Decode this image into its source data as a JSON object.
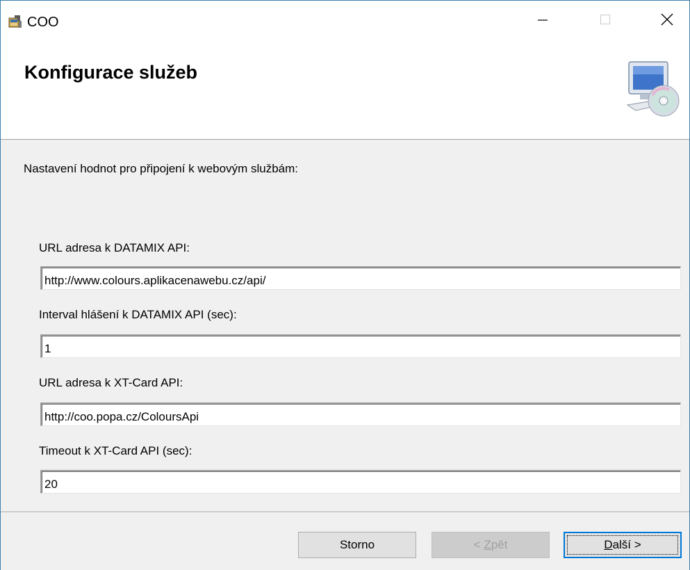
{
  "window": {
    "title": "COO",
    "icons": {
      "app": "installer-icon",
      "minimize": "minimize-icon",
      "maximize": "maximize-icon",
      "close": "close-icon"
    }
  },
  "banner": {
    "title": "Konfigurace služeb",
    "icon": "computer-cd-icon"
  },
  "intro": "Nastavení hodnot pro připojení k webovým službám:",
  "fields": [
    {
      "label": "URL adresa k DATAMIX API:",
      "value": "http://www.colours.aplikacenawebu.cz/api/"
    },
    {
      "label": "Interval hlášení k DATAMIX API (sec):",
      "value": "1"
    },
    {
      "label": "URL adresa k XT-Card API:",
      "value": "http://coo.popa.cz/ColoursApi"
    },
    {
      "label": "Timeout k XT-Card API (sec):",
      "value": "20"
    }
  ],
  "buttons": {
    "cancel": "Storno",
    "back": {
      "prefix": "< ",
      "accel": "Z",
      "rest": "pět",
      "enabled": false
    },
    "next": {
      "accel": "D",
      "rest": "alší >",
      "enabled": true,
      "focused": true
    }
  },
  "colors": {
    "window_border": "#3c7fb1",
    "focus_border": "#0078d7",
    "dialog_bg": "#f0f0f0"
  }
}
